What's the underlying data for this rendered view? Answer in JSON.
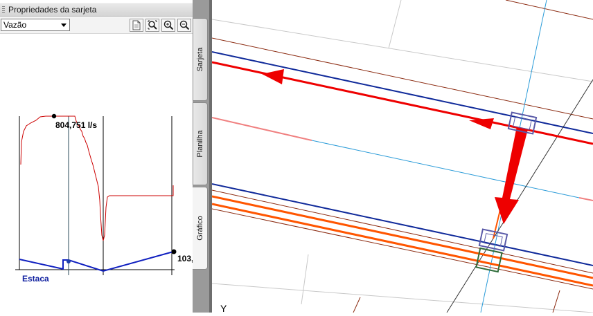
{
  "panel": {
    "title": "Propriedades da sarjeta",
    "combo_value": "Vazão",
    "toolbar": [
      "document-icon",
      "zoom-extents-icon",
      "zoom-in-icon",
      "zoom-out-icon"
    ]
  },
  "graph": {
    "flow_label": "804,751 l/s",
    "right_value_label": "103,",
    "x_axis_label": "Estaca"
  },
  "tabs": {
    "sarjeta": "Sarjeta",
    "planilha": "Planilha",
    "grafico": "Gráfico"
  },
  "canvas": {
    "axis_letter": "Y"
  },
  "colors": {
    "flow_curve": "#cc0000",
    "profile": "#1020c0",
    "red_pipe": "#ee0000",
    "orange_pipe": "#ff5500",
    "navy_line": "#102a9a",
    "cyan_line": "#2a9bd8"
  }
}
